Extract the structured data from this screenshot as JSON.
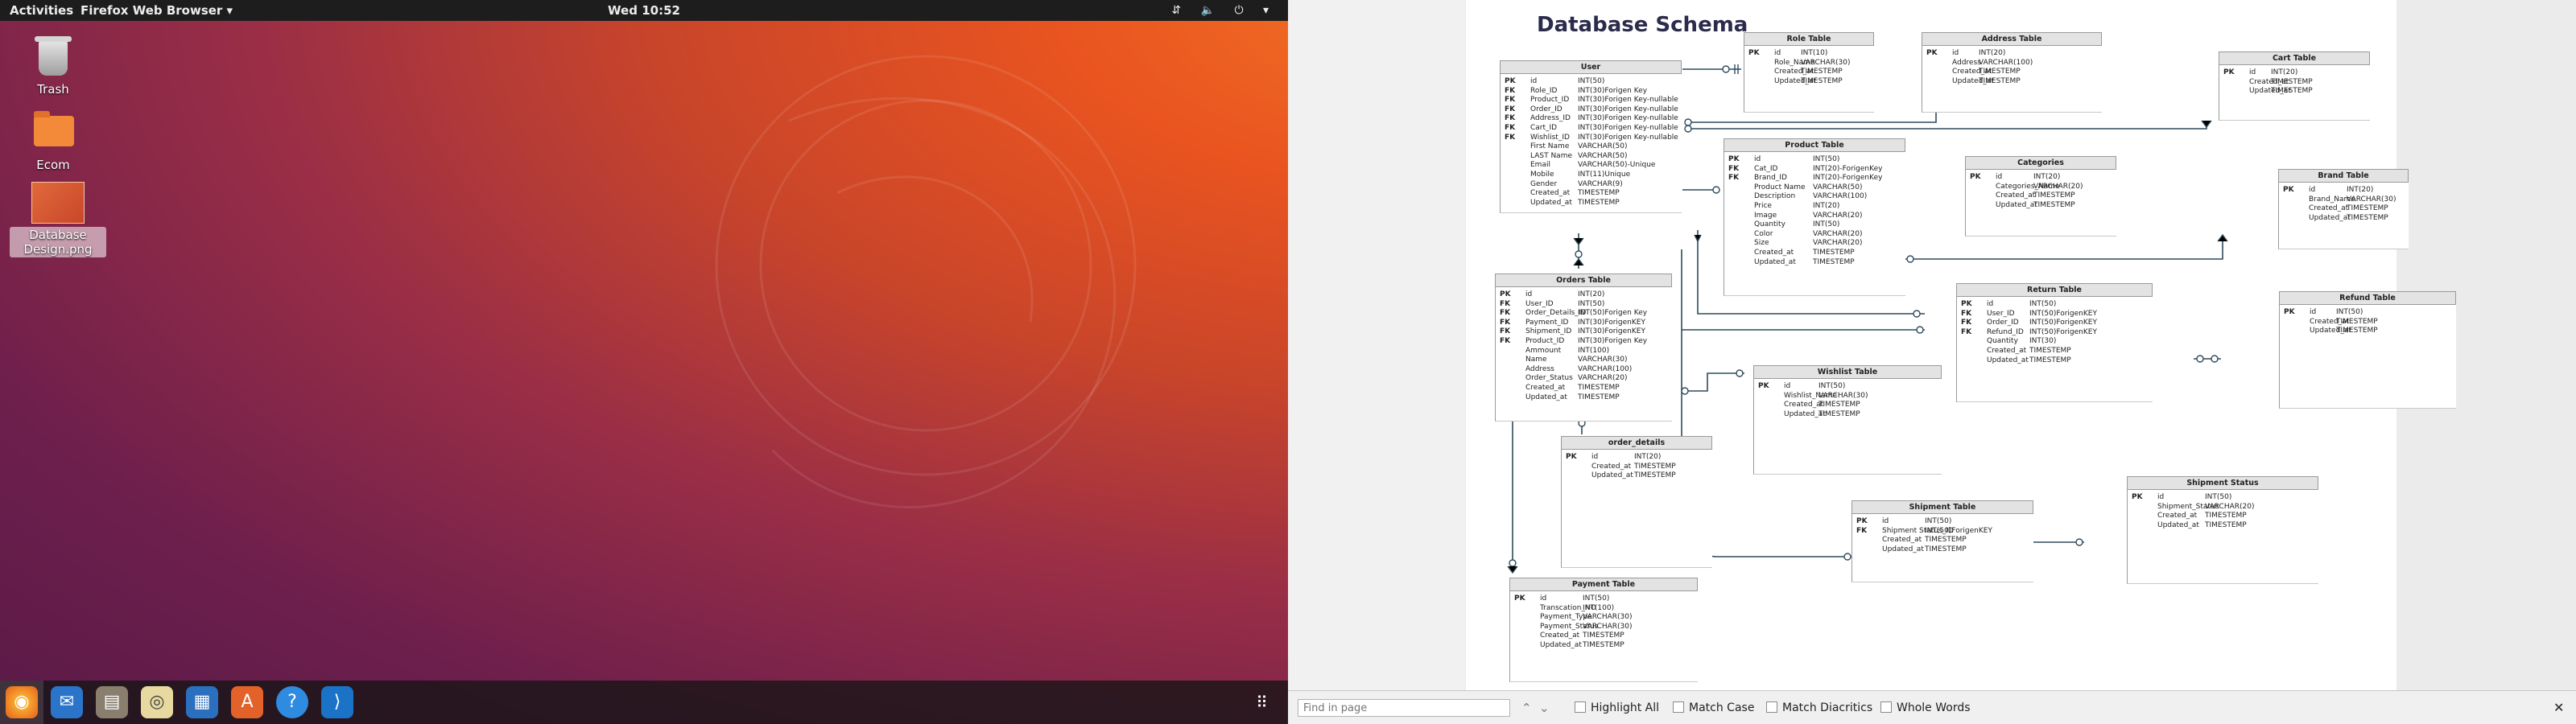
{
  "topbar": {
    "activities": "Activities",
    "app_menu": "Firefox Web Browser ▾",
    "clock": "Wed 10:52",
    "tray": "⇵ 🔈 ⏻ ▾"
  },
  "desktop_icons": [
    {
      "label": "Trash"
    },
    {
      "label": "Ecom"
    },
    {
      "label": "Database Design.png"
    }
  ],
  "dock": [
    "firefox-icon",
    "thunderbird-icon",
    "files-icon",
    "rhythmbox-icon",
    "writer-icon",
    "software-icon",
    "help-icon",
    "vscode-icon"
  ],
  "schema": {
    "title": "Database  Schema",
    "tables": [
      {
        "name": "User",
        "rows": [
          [
            "PK",
            "id",
            "INT(50)"
          ],
          [
            "FK",
            "Role_ID",
            "INT(30)Forigen Key"
          ],
          [
            "FK",
            "Product_ID",
            "INT(30)Forigen Key-nullable"
          ],
          [
            "FK",
            "Order_ID",
            "INT(30)Forigen Key-nullable"
          ],
          [
            "FK",
            "Address_ID",
            "INT(30)Forigen Key-nullable"
          ],
          [
            "FK",
            "Cart_ID",
            "INT(30)Forigen Key-nullable"
          ],
          [
            "FK",
            "Wishlist_ID",
            "INT(30)Forigen Key-nullable"
          ],
          [
            "",
            "First Name",
            "VARCHAR(50)"
          ],
          [
            "",
            "LAST Name",
            "VARCHAR(50)"
          ],
          [
            "",
            "Email",
            "VARCHAR(50)-Unique"
          ],
          [
            "",
            "Mobile",
            "INT(11)Unique"
          ],
          [
            "",
            "Gender",
            "VARCHAR(9)"
          ],
          [
            "",
            "Created_at",
            "TIMESTEMP"
          ],
          [
            "",
            "Updated_at",
            "TIMESTEMP"
          ]
        ]
      },
      {
        "name": "Role Table",
        "rows": [
          [
            "PK",
            "id",
            "INT(10)"
          ],
          [
            "",
            "Role_Name",
            "VARCHAR(30)"
          ],
          [
            "",
            "Created_at",
            "TIMESTEMP"
          ],
          [
            "",
            "Updated_at",
            "TIMESTEMP"
          ]
        ]
      },
      {
        "name": "Address Table",
        "rows": [
          [
            "PK",
            "id",
            "INT(20)"
          ],
          [
            "",
            "Address",
            "VARCHAR(100)"
          ],
          [
            "",
            "Created_at",
            "TIMESTEMP"
          ],
          [
            "",
            "Updated_at",
            "TIMESTEMP"
          ]
        ]
      },
      {
        "name": "Cart Table",
        "rows": [
          [
            "PK",
            "id",
            "INT(20)"
          ],
          [
            "",
            "Created_at",
            "TIMESTEMP"
          ],
          [
            "",
            "Updated_at",
            "TIMESTEMP"
          ]
        ]
      },
      {
        "name": "Product Table",
        "rows": [
          [
            "PK",
            "id",
            "INT(50)"
          ],
          [
            "FK",
            "Cat_ID",
            "INT(20)-ForigenKey"
          ],
          [
            "FK",
            "Brand_ID",
            "INT(20)-ForigenKey"
          ],
          [
            "",
            "Product Name",
            "VARCHAR(50)"
          ],
          [
            "",
            "Description",
            "VARCHAR(100)"
          ],
          [
            "",
            "Price",
            "INT(20)"
          ],
          [
            "",
            "Image",
            "VARCHAR(20)"
          ],
          [
            "",
            "Quantity",
            "INT(50)"
          ],
          [
            "",
            "Color",
            "VARCHAR(20)"
          ],
          [
            "",
            "Size",
            "VARCHAR(20)"
          ],
          [
            "",
            "Created_at",
            "TIMESTEMP"
          ],
          [
            "",
            "Updated_at",
            "TIMESTEMP"
          ]
        ]
      },
      {
        "name": "Categories",
        "rows": [
          [
            "PK",
            "id",
            "INT(20)"
          ],
          [
            "",
            "Categories_Name",
            "VARCHAR(20)"
          ],
          [
            "",
            "Created_at",
            "TIMESTEMP"
          ],
          [
            "",
            "Updated_at",
            "TIMESTEMP"
          ]
        ]
      },
      {
        "name": "Brand Table",
        "rows": [
          [
            "PK",
            "id",
            "INT(20)"
          ],
          [
            "",
            "Brand_Name",
            "VARCHAR(30)"
          ],
          [
            "",
            "Created_at",
            "TIMESTEMP"
          ],
          [
            "",
            "Updated_at",
            "TIMESTEMP"
          ]
        ]
      },
      {
        "name": "Orders Table",
        "rows": [
          [
            "PK",
            "id",
            "INT(20)"
          ],
          [
            "FK",
            "User_ID",
            "INT(50)"
          ],
          [
            "FK",
            "Order_Details_ID",
            "INT(50)Forigen Key"
          ],
          [
            "FK",
            "Payment_ID",
            "INT(30)ForigenKEY"
          ],
          [
            "FK",
            "Shipment_ID",
            "INT(30)ForigenKEY"
          ],
          [
            "FK",
            "Product_ID",
            "INT(30)Forigen Key"
          ],
          [
            "",
            "Ammount",
            "INT(100)"
          ],
          [
            "",
            "Name",
            "VARCHAR(30)"
          ],
          [
            "",
            "Address",
            "VARCHAR(100)"
          ],
          [
            "",
            "Order_Status",
            "VARCHAR(20)"
          ],
          [
            "",
            "Created_at",
            "TIMESTEMP"
          ],
          [
            "",
            "Updated_at",
            "TIMESTEMP"
          ]
        ]
      },
      {
        "name": "Return Table",
        "rows": [
          [
            "PK",
            "id",
            "INT(50)"
          ],
          [
            "FK",
            "User_ID",
            "INT(50)ForigenKEY"
          ],
          [
            "FK",
            "Order_ID",
            "INT(50)ForigenKEY"
          ],
          [
            "FK",
            "Refund_ID",
            "INT(50)ForigenKEY"
          ],
          [
            "",
            "Quantity",
            "INT(30)"
          ],
          [
            "",
            "Created_at",
            "TIMESTEMP"
          ],
          [
            "",
            "Updated_at",
            "TIMESTEMP"
          ]
        ]
      },
      {
        "name": "Refund Table",
        "rows": [
          [
            "PK",
            "id",
            "INT(50)"
          ],
          [
            "",
            "Created_at",
            "TIMESTEMP"
          ],
          [
            "",
            "Updated_at",
            "TIMESTEMP"
          ]
        ]
      },
      {
        "name": "Wishlist Table",
        "rows": [
          [
            "PK",
            "id",
            "INT(50)"
          ],
          [
            "",
            "Wishlist_Name",
            "VARCHAR(30)"
          ],
          [
            "",
            "Created_at",
            "TIMESTEMP"
          ],
          [
            "",
            "Updated_at",
            "TIMESTEMP"
          ]
        ]
      },
      {
        "name": "order_details",
        "rows": [
          [
            "PK",
            "id",
            "INT(20)"
          ],
          [
            "",
            "Created_at",
            "TIMESTEMP"
          ],
          [
            "",
            "Updated_at",
            "TIMESTEMP"
          ]
        ]
      },
      {
        "name": "Shipment Table",
        "rows": [
          [
            "PK",
            "id",
            "INT(50)"
          ],
          [
            "FK",
            "Shipment Status_ID",
            "INT(50)ForigenKEY"
          ],
          [
            "",
            "Created_at",
            "TIMESTEMP"
          ],
          [
            "",
            "Updated_at",
            "TIMESTEMP"
          ]
        ]
      },
      {
        "name": "Shipment Status",
        "rows": [
          [
            "PK",
            "id",
            "INT(50)"
          ],
          [
            "",
            "Shipment_Status",
            "VARCHAR(20)"
          ],
          [
            "",
            "Created_at",
            "TIMESTEMP"
          ],
          [
            "",
            "Updated_at",
            "TIMESTEMP"
          ]
        ]
      },
      {
        "name": "Payment Table",
        "rows": [
          [
            "PK",
            "id",
            "INT(50)"
          ],
          [
            "",
            "Transcation_NO",
            "INT(100)"
          ],
          [
            "",
            "Payment_Type",
            "VARCHAR(30)"
          ],
          [
            "",
            "Payment_Status",
            "VARCHAR(30)"
          ],
          [
            "",
            "Created_at",
            "TIMESTEMP"
          ],
          [
            "",
            "Updated_at",
            "TIMESTEMP"
          ]
        ]
      }
    ]
  },
  "findbar": {
    "placeholder": "Find in page",
    "prev": "⌃",
    "next": "⌄",
    "highlight_all": "Highlight All",
    "match_case": "Match Case",
    "match_diacritics": "Match Diacritics",
    "whole_words": "Whole Words",
    "close": "✕"
  },
  "colors": {
    "accent": "#e95420",
    "line": "#2e4a5c"
  }
}
